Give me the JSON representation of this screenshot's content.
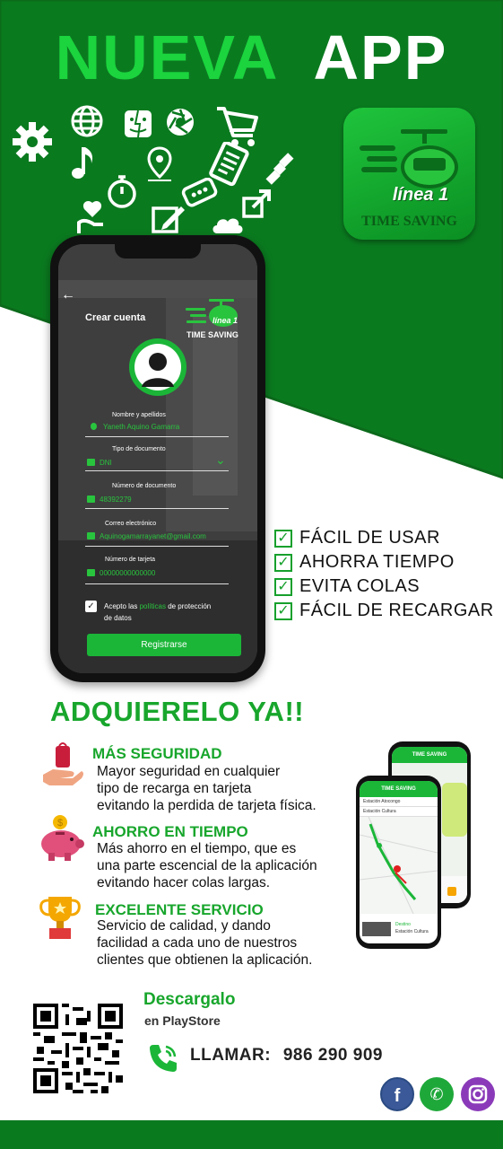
{
  "colors": {
    "brand_green": "#0a7a1f",
    "accent_green": "#1bb638",
    "text_dark": "#111111",
    "white": "#ffffff",
    "facebook": "#3b5998",
    "whatsapp": "#1fa83a",
    "instagram": "#8a3ab9"
  },
  "header": {
    "word1": "NUEVA",
    "word2": "APP"
  },
  "app_icon": {
    "script": "línea 1",
    "name": "TIME SAVING"
  },
  "phone_screen": {
    "title": "Crear cuenta",
    "logo_script": "línea 1",
    "logo_name": "TIME SAVING",
    "fields": [
      {
        "label": "Nombre y apellidos",
        "value": "Yaneth Aquino Gamarra"
      },
      {
        "label": "Tipo de documento",
        "value": "DNI"
      },
      {
        "label": "Número de documento",
        "value": "48392279"
      },
      {
        "label": "Correo electrónico",
        "value": "Aquinogamarrayanet@gmail.com"
      },
      {
        "label": "Número de tarjeta",
        "value": "00000000000000"
      }
    ],
    "terms_prefix": "Acepto las",
    "terms_link": "políticas",
    "terms_suffix": "de protección",
    "terms_line2": "de datos",
    "register_button": "Registrarse"
  },
  "features": [
    "FÁCIL DE USAR",
    "AHORRA TIEMPO",
    "EVITA COLAS",
    "FÁCIL DE RECARGAR"
  ],
  "cta": "ADQUIERELO YA!!",
  "benefits": [
    {
      "icon": "hand-bag-icon",
      "title": "MÁS SEGURIDAD",
      "lines": [
        "Mayor seguridad en cualquier",
        "tipo de recarga en tarjeta",
        "evitando la perdida de tarjeta física."
      ]
    },
    {
      "icon": "piggy-bank-icon",
      "title": "AHORRO EN TIEMPO",
      "lines": [
        "Más ahorro en el tiempo, que es",
        "una parte escencial de la aplicación",
        "evitando hacer colas largas."
      ]
    },
    {
      "icon": "trophy-icon",
      "title": "EXCELENTE SERVICIO",
      "lines": [
        "Servicio de calidad, y dando",
        "facilidad a cada uno de nuestros",
        "clientes que obtienen la aplicación."
      ]
    }
  ],
  "map_phone": {
    "header": "TIME SAVING",
    "origin": "Estación Atocongo",
    "destination": "Estación Cultura",
    "footer_title": "Destino",
    "footer_sub": "Estación Cultura"
  },
  "download": {
    "title": "Descargalo",
    "subtitle": "en PlayStore"
  },
  "call": {
    "label": "LLAMAR:",
    "number": "986 290 909"
  },
  "social": [
    "facebook-icon",
    "whatsapp-icon",
    "instagram-icon"
  ]
}
